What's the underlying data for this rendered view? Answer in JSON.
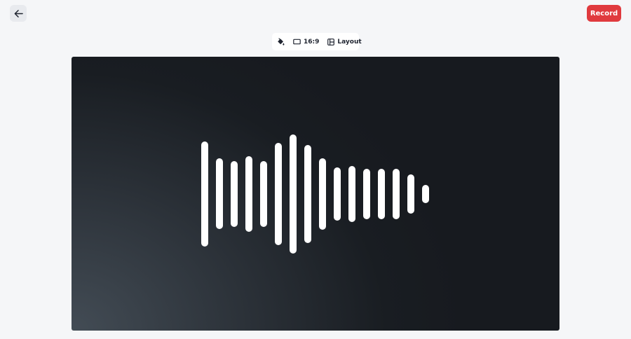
{
  "header": {
    "back_icon": "arrow-left-icon",
    "record_label": "Record",
    "record_color": "#e03a3e"
  },
  "toolbar": {
    "background_icon": "paint-bucket-icon",
    "aspect_icon": "rectangle-icon",
    "aspect_label": "16:9",
    "layout_icon": "layout-icon",
    "layout_label": "Layout"
  },
  "canvas": {
    "waveform_icon": "audio-waveform-icon",
    "bar_color": "#ffffff"
  }
}
